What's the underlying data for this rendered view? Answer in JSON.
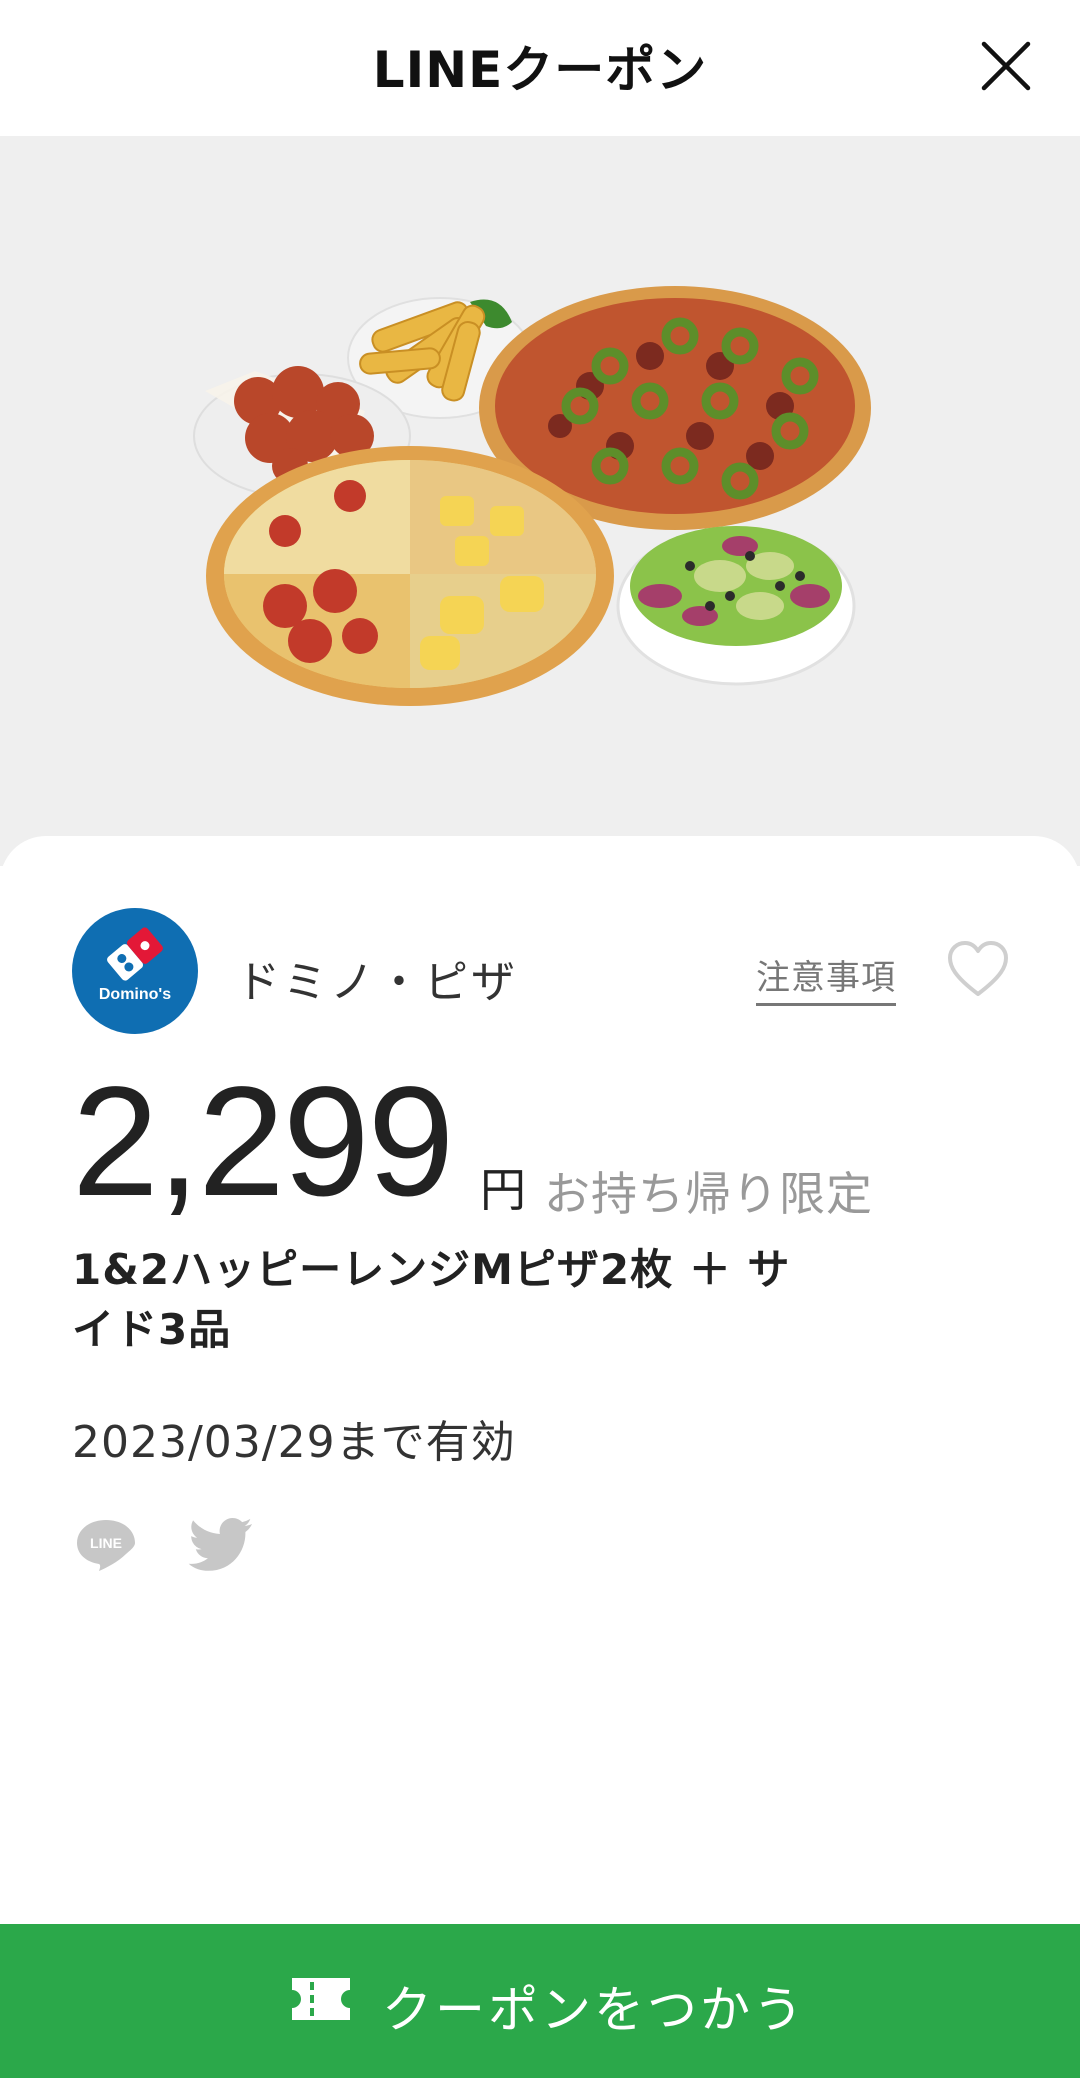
{
  "header": {
    "title": "LINEクーポン",
    "close_icon": "close-icon"
  },
  "merchant": {
    "name": "ドミノ・ピザ",
    "logo_text": "Domino's",
    "notes_label": "注意事項",
    "favorite_icon": "heart-icon"
  },
  "offer": {
    "price": "2,299",
    "currency": "円",
    "condition": "お持ち帰り限定",
    "description": "1&2ハッピーレンジMピザ2枚 ＋ サイド3品",
    "validity": "2023/03/29まで有効"
  },
  "share": {
    "line_icon": "line-icon",
    "twitter_icon": "twitter-icon"
  },
  "cta": {
    "label": "クーポンをつかう",
    "icon": "ticket-icon"
  },
  "colors": {
    "accent": "#2ba84a",
    "brand_blue": "#0f6eb2",
    "hero_bg": "#efefef"
  }
}
